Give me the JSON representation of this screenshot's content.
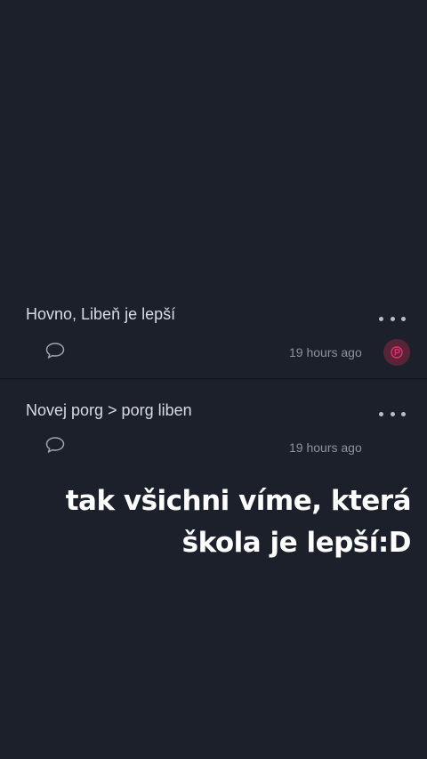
{
  "posts": [
    {
      "text": "Hovno, Libeň je lepší",
      "time": "19 hours ago",
      "icons": {
        "more": "more-dots-icon",
        "comment": "comment-bubble-icon",
        "avatar": "user-avatar"
      }
    },
    {
      "text": "Novej porg > porg liben",
      "time": "19 hours ago",
      "icons": {
        "more": "more-dots-icon",
        "comment": "comment-bubble-icon"
      }
    }
  ],
  "overlay": {
    "line1": "tak všichni víme, která",
    "line2": "škola je lepší:D"
  },
  "colors": {
    "background": "#1b202b",
    "text": "#d8dbe1",
    "muted": "#8d929c",
    "avatar_bg": "#5a2438",
    "avatar_fg": "#e0306a"
  }
}
